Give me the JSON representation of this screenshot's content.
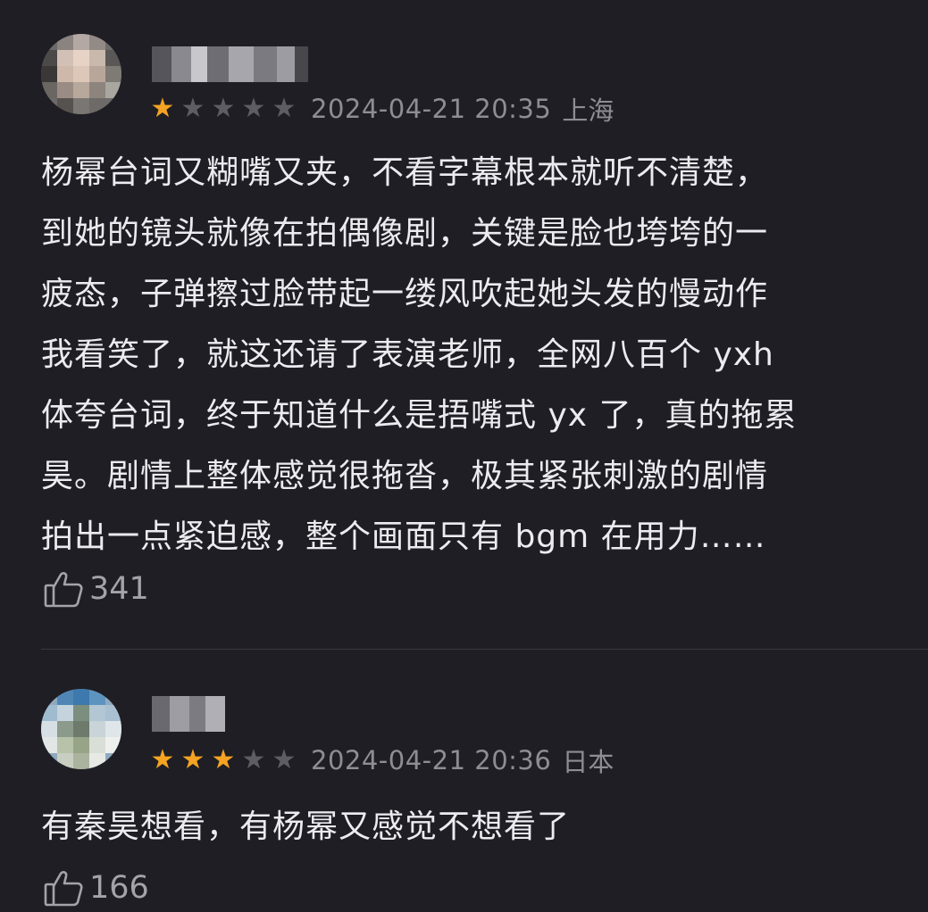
{
  "comments": [
    {
      "stars": [
        true,
        false,
        false,
        false,
        false
      ],
      "time": "2024-04-21 20:35",
      "location": "上海",
      "lines": [
        "杨幂台词又糊嘴又夹，不看字幕根本就听不清楚，",
        "到她的镜头就像在拍偶像剧，关键是脸也垮垮的一",
        "疲态，子弹擦过脸带起一缕风吹起她头发的慢动作",
        "我看笑了，就这还请了表演老师，全网八百个 yxh",
        "体夸台词，终于知道什么是捂嘴式 yx 了，真的拖累",
        "昊。剧情上整体感觉很拖沓，极其紧张刺激的剧情",
        "拍出一点紧迫感，整个画面只有 bgm 在用力……"
      ],
      "likes": "341"
    },
    {
      "stars": [
        true,
        true,
        true,
        false,
        false
      ],
      "time": "2024-04-21 20:36",
      "location": "日本",
      "lines": [
        "有秦昊想看，有杨幂又感觉不想看了"
      ],
      "likes": "166"
    }
  ],
  "colors": {
    "background": "#1f1e24",
    "star_on": "#f4a322",
    "star_off": "#5e5d63",
    "meta_text": "#8e8d93"
  },
  "icons": {
    "like": "thumbs-up-icon",
    "star": "star-icon"
  }
}
